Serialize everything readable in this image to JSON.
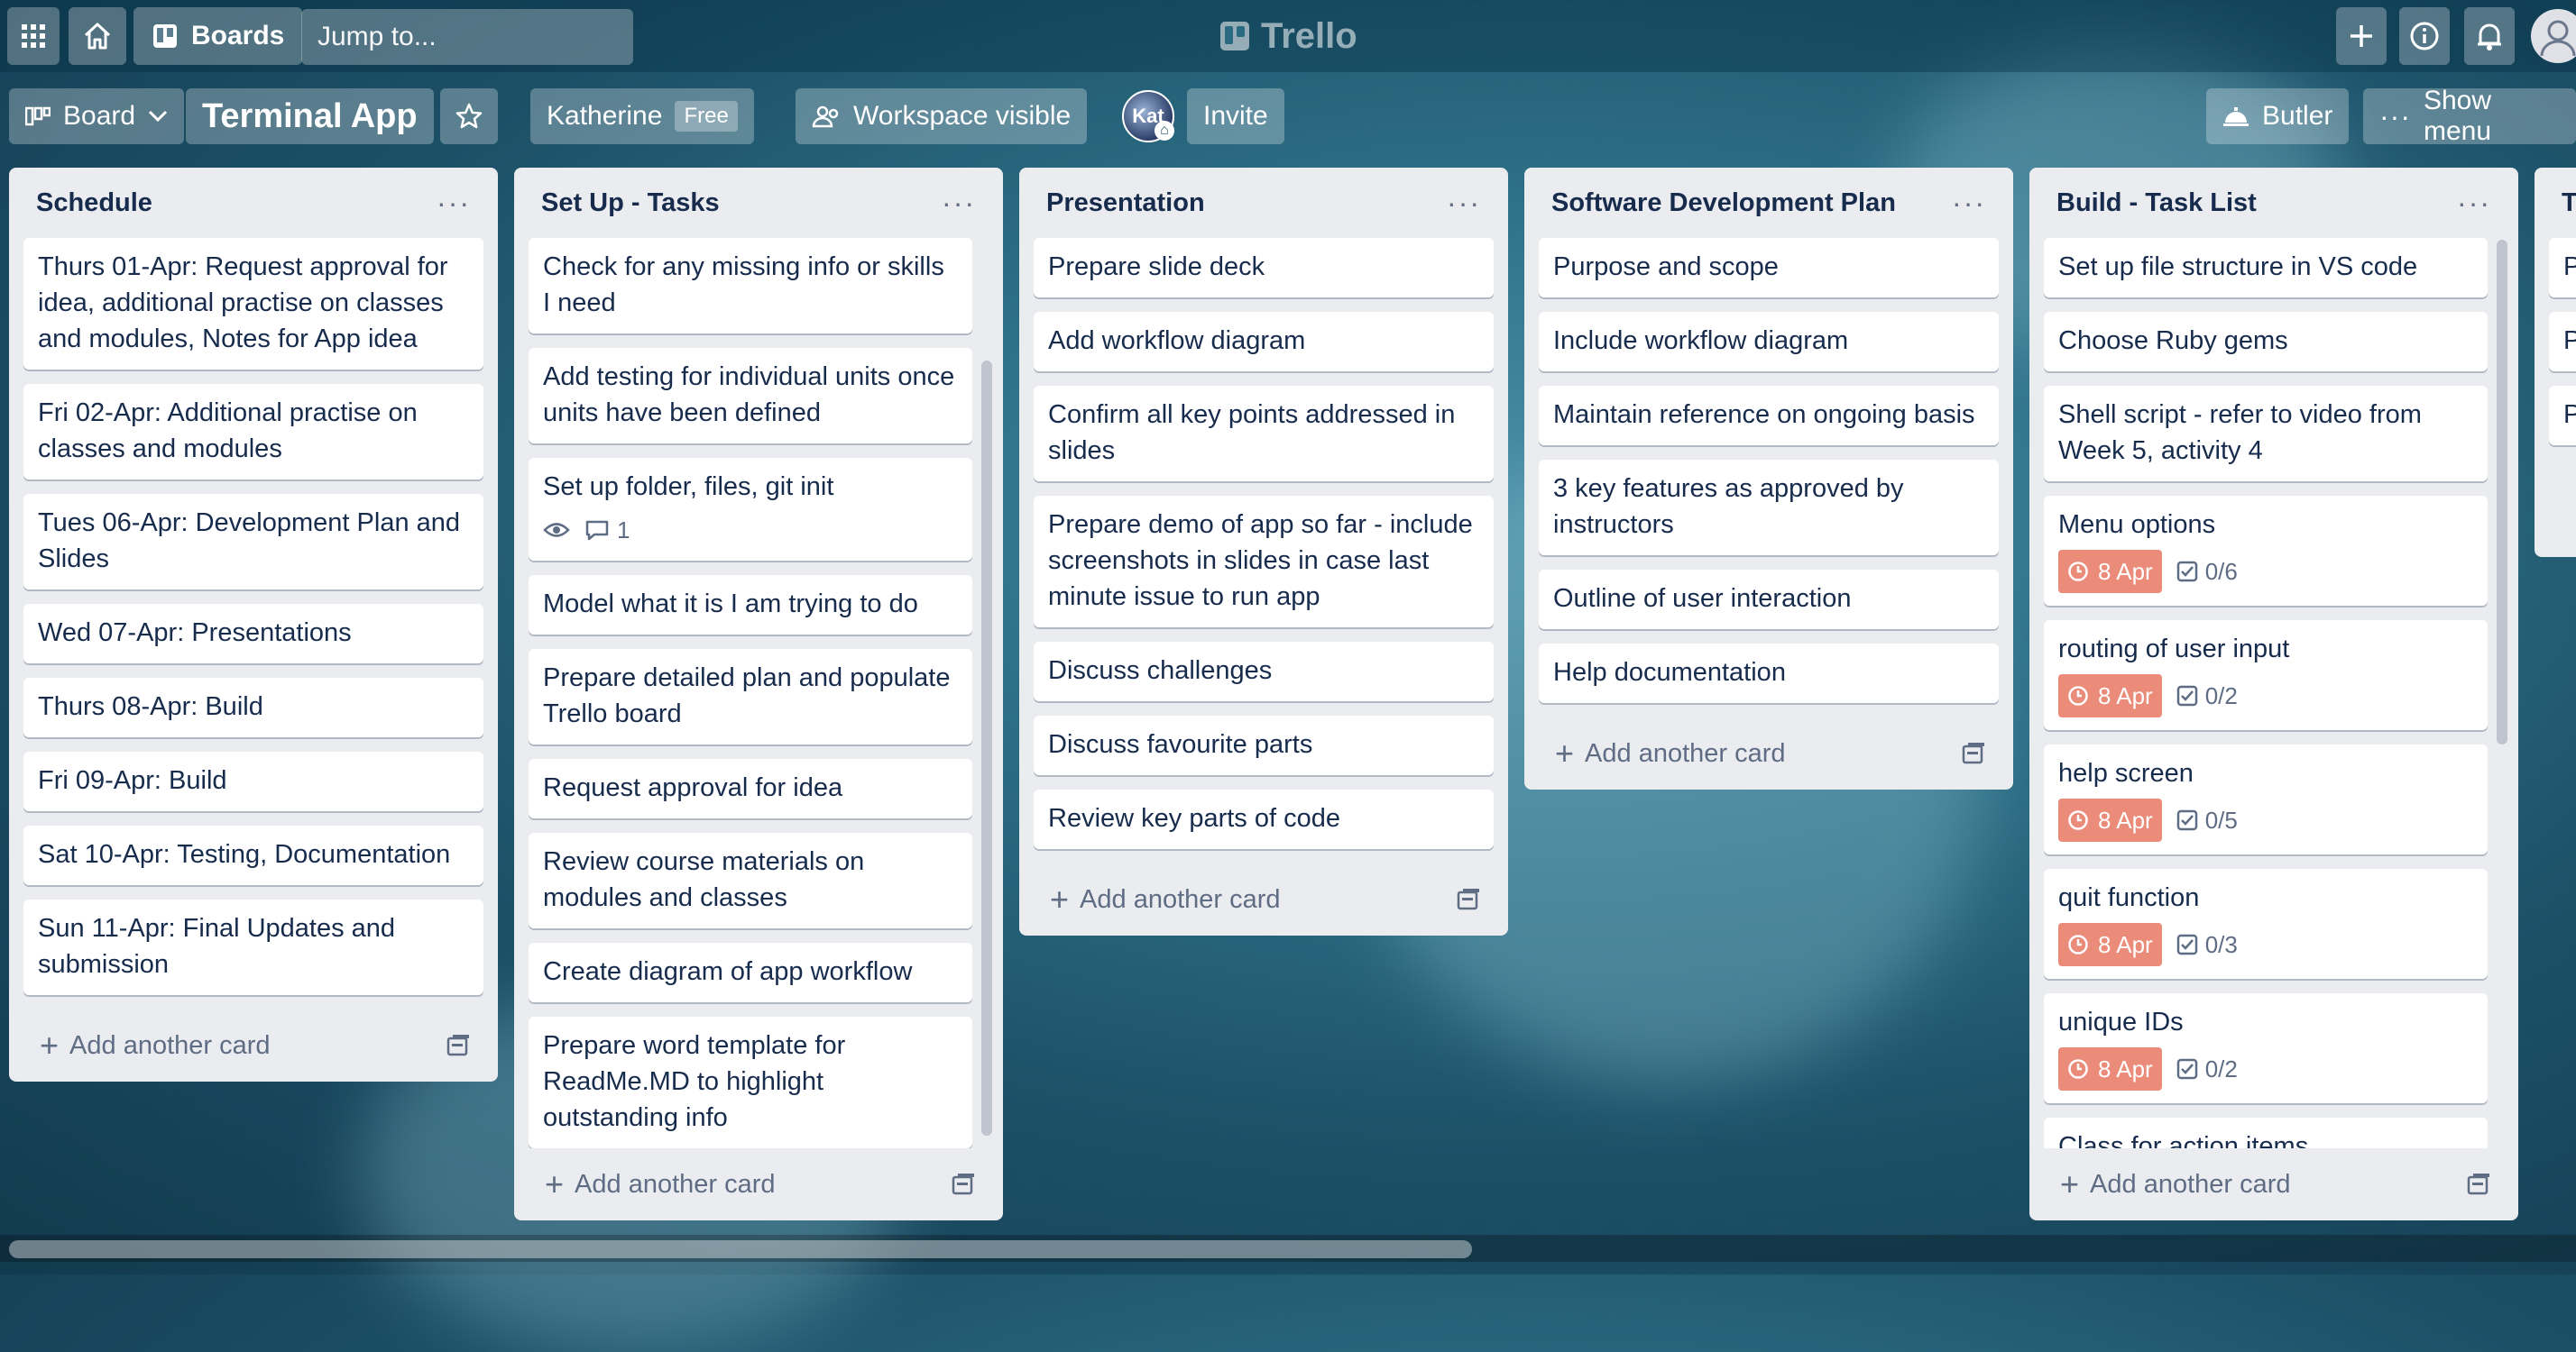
{
  "nav": {
    "boards_label": "Boards",
    "jump_placeholder": "Jump to...",
    "logo_text": "Trello"
  },
  "board": {
    "view_label": "Board",
    "title": "Terminal App",
    "workspace_name": "Katherine",
    "workspace_plan": "Free",
    "visibility_label": "Workspace visible",
    "avatar_initials": "Kat",
    "invite_label": "Invite",
    "butler_label": "Butler",
    "menu_label": "Show menu"
  },
  "add_card_label": "Add another card",
  "lists": [
    {
      "title": "Schedule",
      "cards": [
        {
          "text": "Thurs 01-Apr: Request approval for idea, additional practise on classes and modules, Notes for App idea"
        },
        {
          "text": "Fri 02-Apr: Additional practise on classes and modules"
        },
        {
          "text": "Tues 06-Apr: Development Plan and Slides"
        },
        {
          "text": "Wed 07-Apr: Presentations"
        },
        {
          "text": "Thurs 08-Apr: Build"
        },
        {
          "text": "Fri 09-Apr: Build"
        },
        {
          "text": "Sat 10-Apr: Testing, Documentation"
        },
        {
          "text": "Sun 11-Apr: Final Updates and submission"
        }
      ]
    },
    {
      "title": "Set Up - Tasks",
      "cards": [
        {
          "text": "Check for any missing info or skills I need"
        },
        {
          "text": "Add testing for individual units once units have been defined"
        },
        {
          "text": "Set up folder, files, git init",
          "watch": true,
          "comments": "1"
        },
        {
          "text": "Model what it is I am trying to do"
        },
        {
          "text": "Prepare detailed plan and populate Trello board"
        },
        {
          "text": "Request approval for idea"
        },
        {
          "text": "Review course materials on modules and classes"
        },
        {
          "text": "Create diagram of app workflow"
        },
        {
          "text": "Prepare word template for ReadMe.MD to highlight outstanding info"
        }
      ]
    },
    {
      "title": "Presentation",
      "cards": [
        {
          "text": "Prepare slide deck"
        },
        {
          "text": "Add workflow diagram"
        },
        {
          "text": "Confirm all key points addressed in slides"
        },
        {
          "text": "Prepare demo of app so far - include screenshots in slides in case last minute issue to run app"
        },
        {
          "text": "Discuss challenges"
        },
        {
          "text": "Discuss favourite parts"
        },
        {
          "text": "Review key parts of code"
        }
      ]
    },
    {
      "title": "Software Development Plan",
      "cards": [
        {
          "text": "Purpose and scope"
        },
        {
          "text": "Include workflow diagram"
        },
        {
          "text": "Maintain reference on ongoing basis"
        },
        {
          "text": "3 key features as approved by instructors"
        },
        {
          "text": "Outline of user interaction"
        },
        {
          "text": "Help documentation"
        }
      ]
    },
    {
      "title": "Build - Task List",
      "cards": [
        {
          "text": "Set up file structure in VS code"
        },
        {
          "text": "Choose Ruby gems"
        },
        {
          "text": "Shell script - refer to video from Week 5, activity 4"
        },
        {
          "text": "Menu options",
          "due": "8 Apr",
          "checklist": "0/6"
        },
        {
          "text": "routing of user input",
          "due": "8 Apr",
          "checklist": "0/2"
        },
        {
          "text": "help screen",
          "due": "8 Apr",
          "checklist": "0/5"
        },
        {
          "text": "quit function",
          "due": "8 Apr",
          "checklist": "0/3"
        },
        {
          "text": "unique IDs",
          "due": "8 Apr",
          "checklist": "0/2"
        },
        {
          "text": "Class for action items"
        }
      ]
    },
    {
      "title": "T",
      "cards": [
        {
          "text": "P"
        },
        {
          "text": "P"
        },
        {
          "text": "P te"
        }
      ]
    }
  ],
  "colors": {
    "due_badge": "#eb8b7a",
    "list_bg": "#ebecf0",
    "card_bg": "#ffffff"
  }
}
